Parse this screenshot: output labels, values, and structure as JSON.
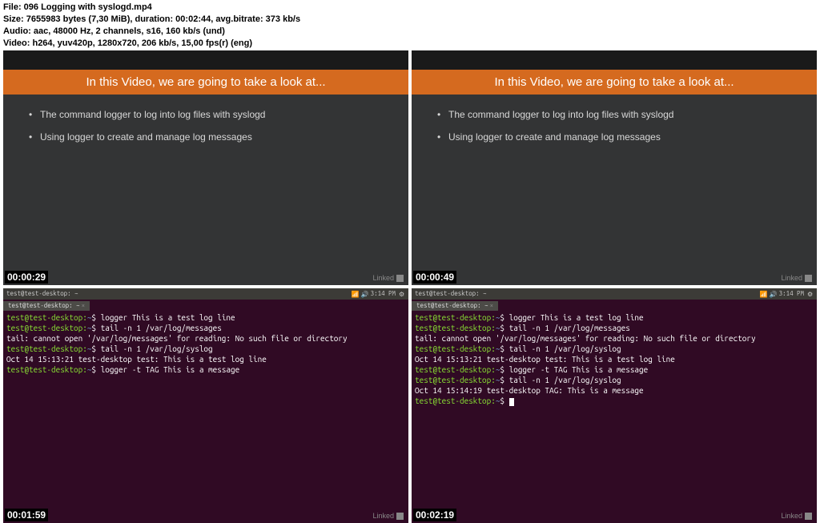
{
  "meta": {
    "l1": "File: 096 Logging with syslogd.mp4",
    "l2": "Size: 7655983 bytes (7,30 MiB), duration: 00:02:44, avg.bitrate: 373 kb/s",
    "l3": "Audio: aac, 48000 Hz, 2 channels, s16, 160 kb/s (und)",
    "l4": "Video: h264, yuv420p, 1280x720, 206 kb/s, 15,00 fps(r) (eng)"
  },
  "slide": {
    "title": "In this Video, we are going to take a look at...",
    "b1": "The command logger to log into log files with syslogd",
    "b2": "Using logger to create and manage log messages"
  },
  "term": {
    "barTitle": "test@test-desktop: ~",
    "time": "3:14 PM",
    "prompt": "test@test-desktop:",
    "tilde": "~",
    "dollar": "$ ",
    "c1": "logger This is a test log line",
    "c2": "tail -n 1 /var/log/messages",
    "err": "tail: cannot open '/var/log/messages' for reading: No such file or directory",
    "c3": "tail -n 1 /var/log/syslog",
    "out1": "Oct 14 15:13:21 test-desktop test: This is a test log line",
    "c4": "logger -t TAG This is a message",
    "out2": "Oct 14 15:14:19 test-desktop TAG: This is a message"
  },
  "ts": {
    "t1": "00:00:29",
    "t2": "00:00:49",
    "t3": "00:01:59",
    "t4": "00:02:19"
  },
  "logo": "Linked"
}
